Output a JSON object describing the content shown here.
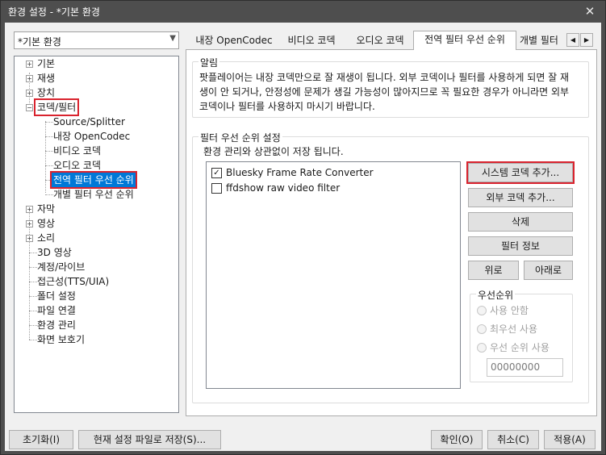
{
  "window": {
    "title": "환경 설정 - *기본 환경",
    "close_glyph": "✕"
  },
  "preset": {
    "value": "*기본 환경"
  },
  "tree": [
    {
      "label": "기본",
      "expander": "+"
    },
    {
      "label": "재생",
      "expander": "+"
    },
    {
      "label": "장치",
      "expander": "+"
    },
    {
      "label": "코덱/필터",
      "expander": "−"
    },
    {
      "label": "Source/Splitter"
    },
    {
      "label": "내장 OpenCodec"
    },
    {
      "label": "비디오 코덱"
    },
    {
      "label": "오디오 코덱"
    },
    {
      "label": "전역 필터 우선 순위"
    },
    {
      "label": "개별 필터 우선 순위"
    },
    {
      "label": "자막",
      "expander": "+"
    },
    {
      "label": "영상",
      "expander": "+"
    },
    {
      "label": "소리",
      "expander": "+"
    },
    {
      "label": "3D 영상"
    },
    {
      "label": "계정/라이브"
    },
    {
      "label": "접근성(TTS/UIA)"
    },
    {
      "label": "폴더 설정"
    },
    {
      "label": "파일 연결"
    },
    {
      "label": "환경 관리"
    },
    {
      "label": "화면 보호기"
    }
  ],
  "tabs": [
    "내장 OpenCodec",
    "비디오 코덱",
    "오디오 코덱",
    "전역 필터 우선 순위",
    "개별 필터"
  ],
  "tab_scroll": {
    "left": "◀",
    "right": "▶"
  },
  "notice": {
    "title": "알림",
    "text": "팟플레이어는 내장 코덱만으로 잘 재생이 됩니다. 외부 코덱이나 필터를 사용하게 되면 잘 재생이 안 되거나, 안정성에 문제가 생길 가능성이 많아지므로 꼭 필요한 경우가 아니라면 외부 코덱이나 필터를 사용하지 마시기 바랍니다."
  },
  "priority": {
    "title": "필터 우선 순위 설정",
    "subtitle": "환경 관리와 상관없이 저장 됩니다.",
    "filters": [
      {
        "label": "Bluesky Frame Rate Converter",
        "checked": true
      },
      {
        "label": "ffdshow raw video filter",
        "checked": false
      }
    ],
    "buttons": {
      "add_system": "시스템 코덱 추가...",
      "add_external": "외부 코덱 추가...",
      "delete": "삭제",
      "filter_info": "필터 정보",
      "up": "위로",
      "down": "아래로"
    },
    "order_group": {
      "title": "우선순위",
      "options": [
        "사용 안함",
        "최우선 사용",
        "우선 순위 사용"
      ],
      "value": "00000000"
    }
  },
  "footer": {
    "reset": "초기화(I)",
    "save_file": "현재 설정 파일로 저장(S)...",
    "ok": "확인(O)",
    "cancel": "취소(C)",
    "apply": "적용(A)"
  },
  "colors": {
    "highlight": "#d9232e",
    "selection": "#0078d7"
  }
}
